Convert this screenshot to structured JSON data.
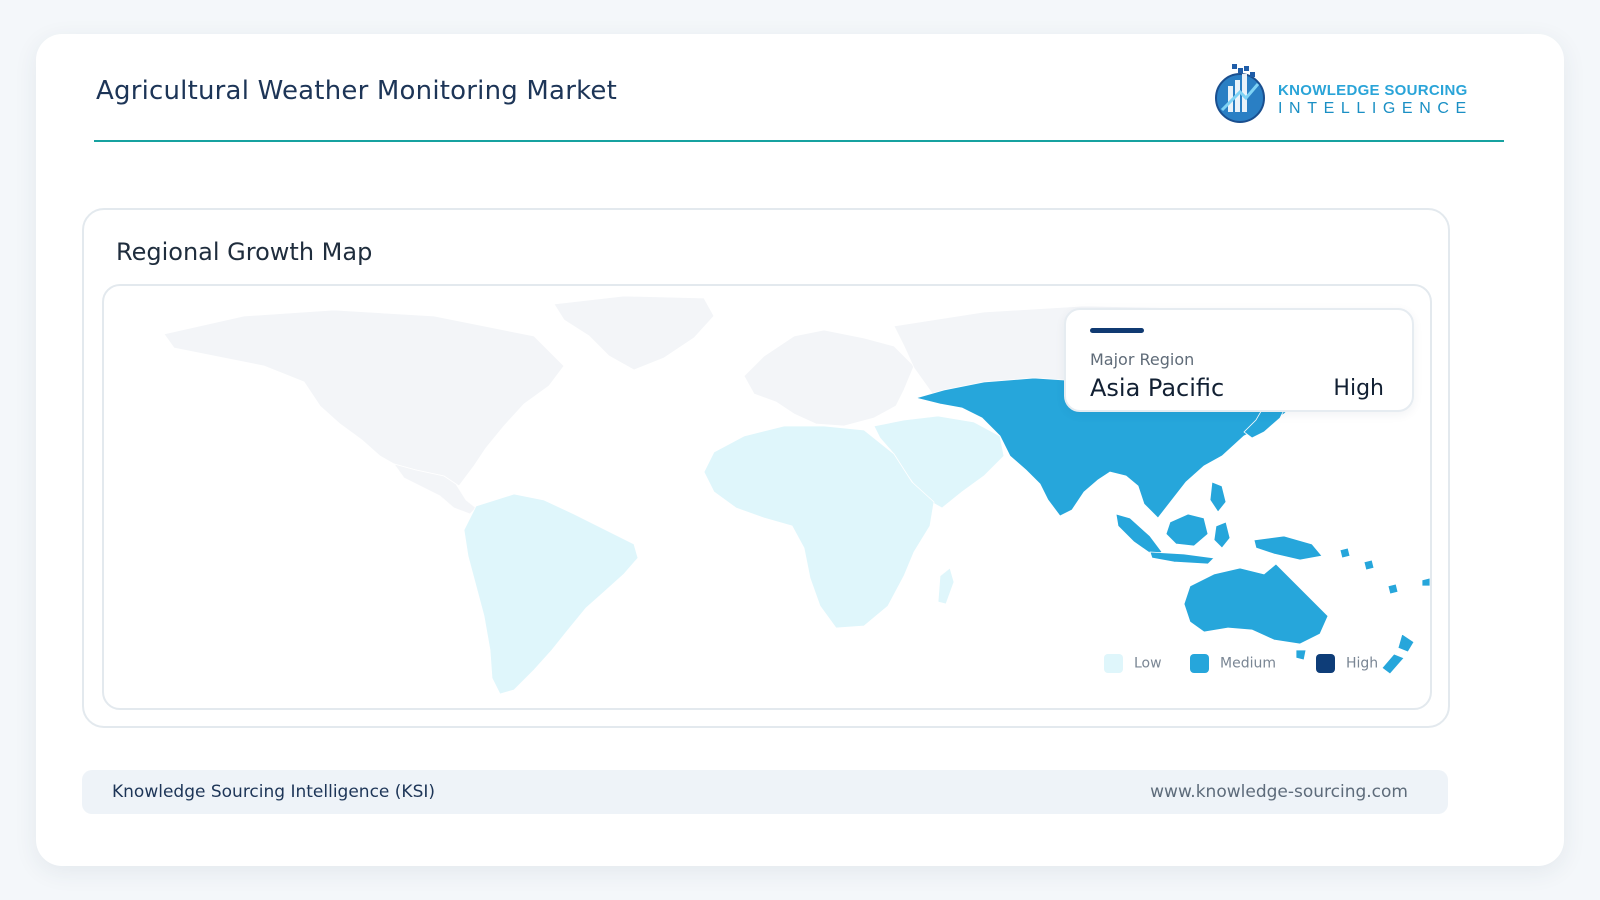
{
  "header": {
    "title": "Agricultural Weather Monitoring Market"
  },
  "logo": {
    "line1": "KNOWLEDGE SOURCING",
    "line2": "INTELLIGENCE"
  },
  "panel": {
    "title": "Regional Growth Map"
  },
  "info": {
    "label": "Major Region",
    "region": "Asia Pacific",
    "level": "High"
  },
  "legend": [
    {
      "label": "Low",
      "color": "#dff6fb"
    },
    {
      "label": "Medium",
      "color": "#26a6db"
    },
    {
      "label": "High",
      "color": "#0e3d78"
    }
  ],
  "map": {
    "regions": [
      {
        "name": "North America",
        "level": "none"
      },
      {
        "name": "Greenland",
        "level": "none"
      },
      {
        "name": "Europe",
        "level": "none"
      },
      {
        "name": "Russia",
        "level": "none"
      },
      {
        "name": "South America",
        "level": "Low"
      },
      {
        "name": "Africa",
        "level": "Low"
      },
      {
        "name": "Middle East",
        "level": "Low"
      },
      {
        "name": "Asia Pacific",
        "level": "Medium"
      }
    ],
    "colors": {
      "none": "#f3f5f8",
      "Low": "#dff6fb",
      "Medium": "#26a6db",
      "High": "#0e3d78"
    }
  },
  "footer": {
    "left": "Knowledge Sourcing Intelligence (KSI)",
    "right": "www.knowledge-sourcing.com"
  }
}
